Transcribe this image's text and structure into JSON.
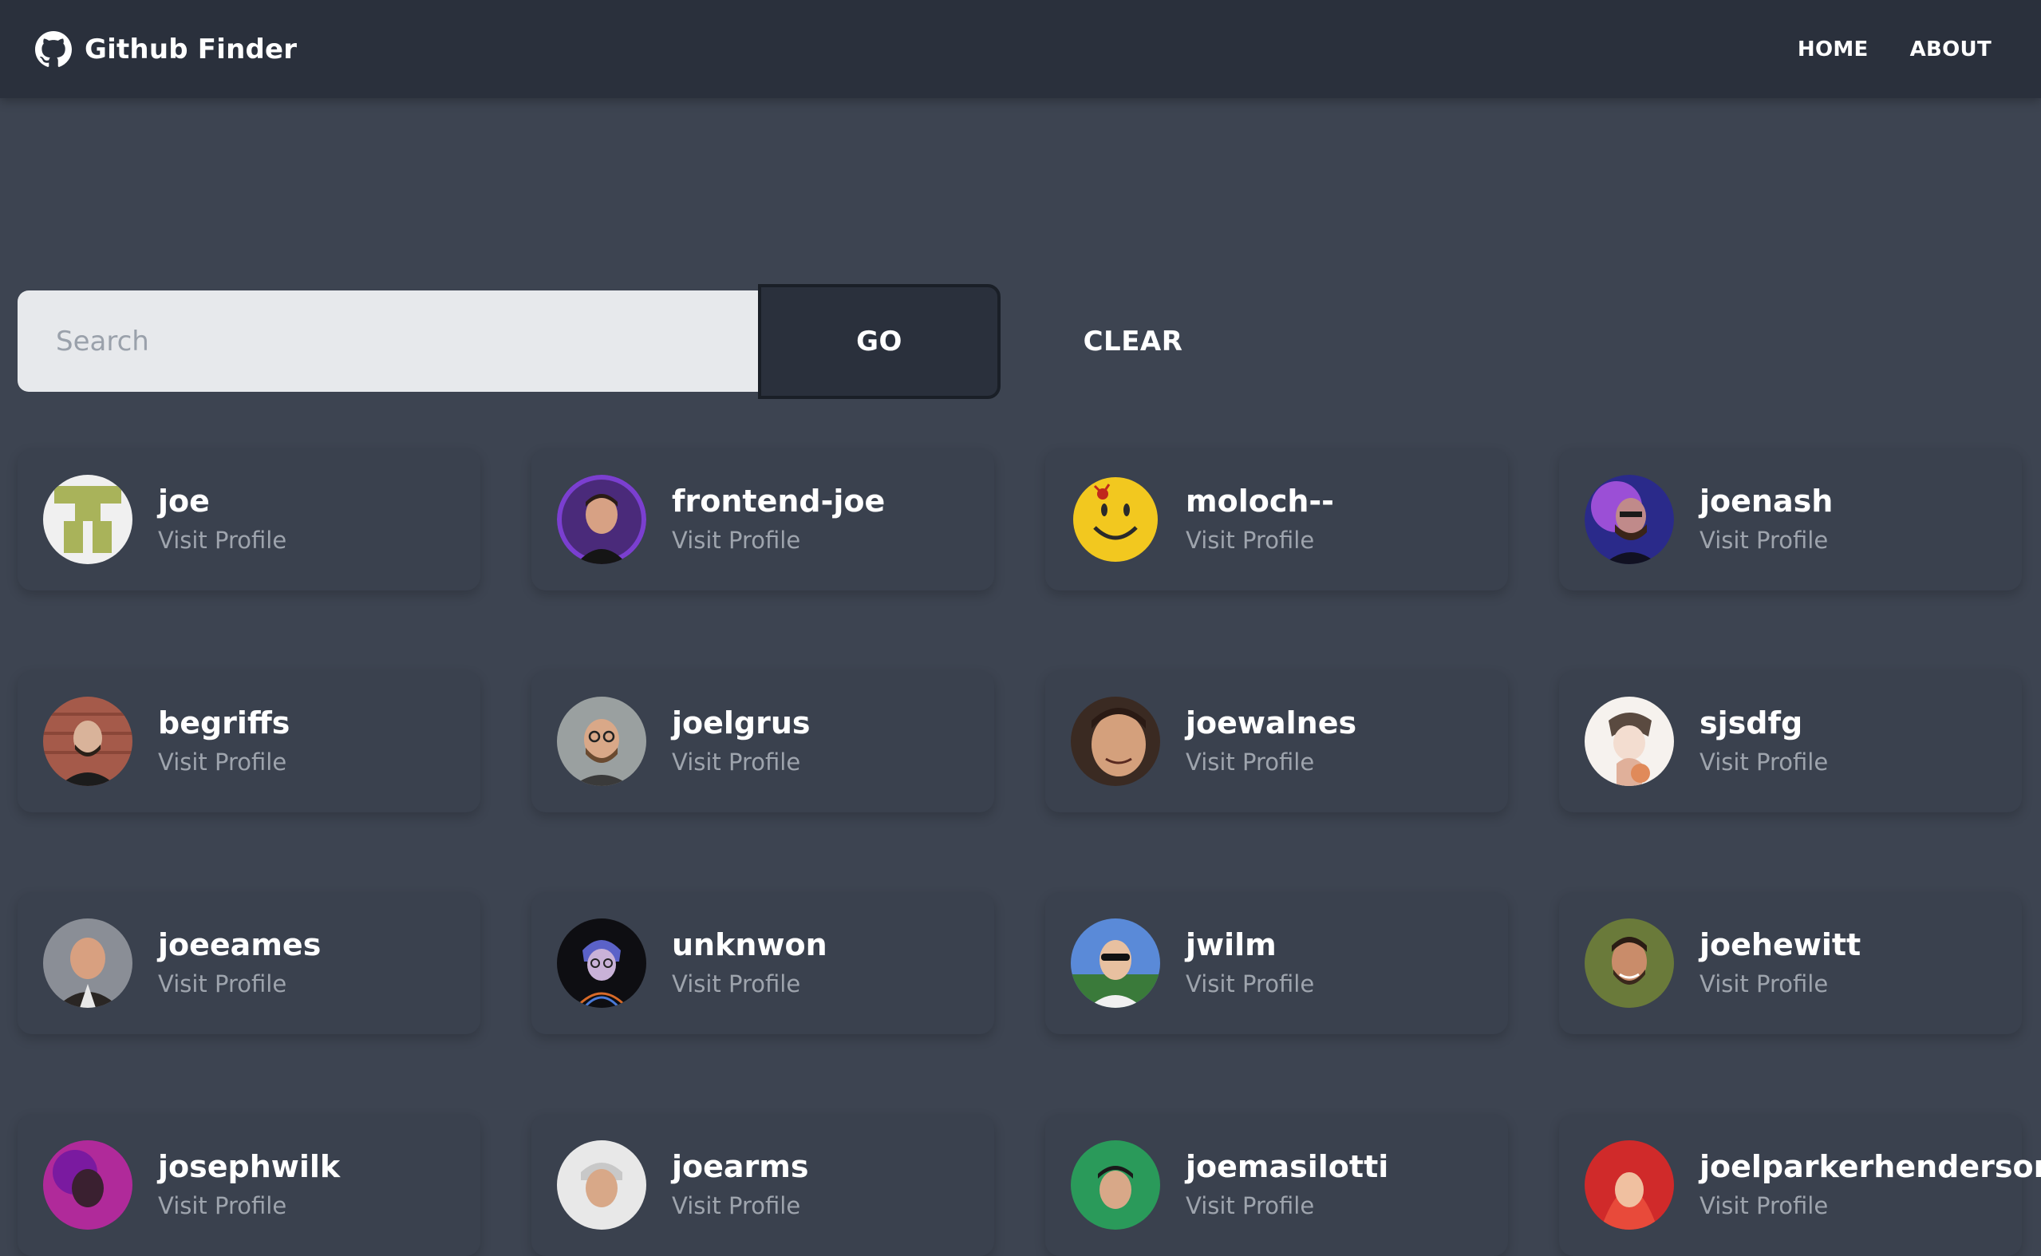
{
  "navbar": {
    "title": "Github Finder",
    "icon": "github-icon",
    "links": [
      {
        "label": "HOME"
      },
      {
        "label": "ABOUT"
      }
    ]
  },
  "search": {
    "placeholder": "Search",
    "value": "",
    "go_label": "GO",
    "clear_label": "CLEAR"
  },
  "colors": {
    "background": "#3d4451",
    "navbar": "#2a303c",
    "card": "#3a414e",
    "muted_text": "#9ea4ad"
  },
  "users": [
    {
      "login": "joe",
      "link_label": "Visit Profile",
      "avatar": "identicon-avatar"
    },
    {
      "login": "frontend-joe",
      "link_label": "Visit Profile",
      "avatar": "portrait-avatar"
    },
    {
      "login": "moloch--",
      "link_label": "Visit Profile",
      "avatar": "smiley-avatar"
    },
    {
      "login": "joenash",
      "link_label": "Visit Profile",
      "avatar": "portrait-avatar"
    },
    {
      "login": "begriffs",
      "link_label": "Visit Profile",
      "avatar": "portrait-avatar"
    },
    {
      "login": "joelgrus",
      "link_label": "Visit Profile",
      "avatar": "portrait-avatar"
    },
    {
      "login": "joewalnes",
      "link_label": "Visit Profile",
      "avatar": "portrait-avatar"
    },
    {
      "login": "sjsdfg",
      "link_label": "Visit Profile",
      "avatar": "illustration-avatar"
    },
    {
      "login": "joeeames",
      "link_label": "Visit Profile",
      "avatar": "portrait-avatar"
    },
    {
      "login": "unknwon",
      "link_label": "Visit Profile",
      "avatar": "illustration-avatar"
    },
    {
      "login": "jwilm",
      "link_label": "Visit Profile",
      "avatar": "portrait-avatar"
    },
    {
      "login": "joehewitt",
      "link_label": "Visit Profile",
      "avatar": "portrait-avatar"
    },
    {
      "login": "josephwilk",
      "link_label": "Visit Profile",
      "avatar": "portrait-avatar"
    },
    {
      "login": "joearms",
      "link_label": "Visit Profile",
      "avatar": "portrait-avatar"
    },
    {
      "login": "joemasilotti",
      "link_label": "Visit Profile",
      "avatar": "portrait-avatar"
    },
    {
      "login": "joelparkerhenderson",
      "link_label": "Visit Profile",
      "avatar": "portrait-avatar"
    }
  ]
}
